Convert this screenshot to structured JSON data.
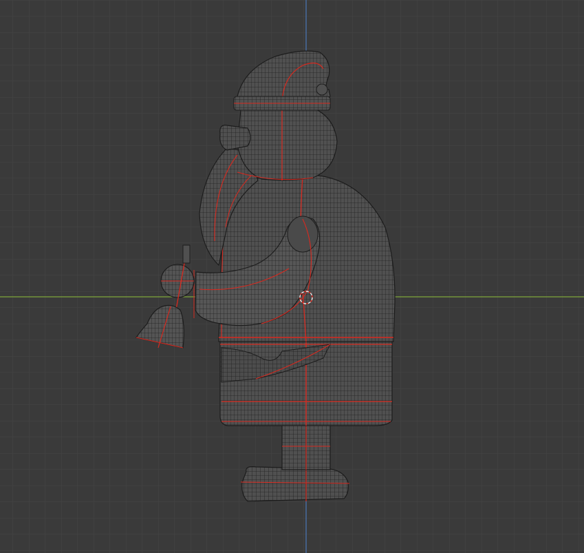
{
  "viewport": {
    "background": "#3a3a3a",
    "grid_minor_color": "#434343",
    "grid_major_color": "#2f2f2f",
    "x_axis_color": "#8ab33a",
    "z_axis_color": "#4a78b8"
  },
  "object": {
    "wire_color": "#1c1c1c",
    "solid_color": "#4d4d4d",
    "seam_color": "#d8291f",
    "origin_marker_color": "#e6e6e6"
  }
}
